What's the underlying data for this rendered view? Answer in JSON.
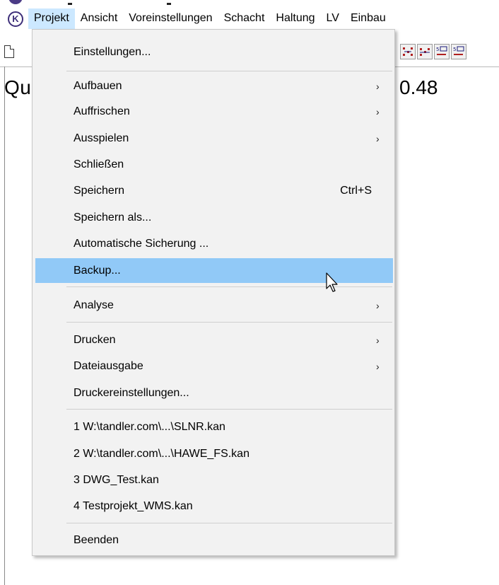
{
  "menubar": {
    "app_icon_glyph": "K",
    "items": [
      {
        "label": "Projekt"
      },
      {
        "label": "Ansicht"
      },
      {
        "label": "Voreinstellungen"
      },
      {
        "label": "Schacht"
      },
      {
        "label": "Haltung"
      },
      {
        "label": "LV"
      },
      {
        "label": "Einbau"
      }
    ]
  },
  "main": {
    "label": "Qu",
    "value": "0.48"
  },
  "dropdown": {
    "items": {
      "einstellungen": "Einstellungen...",
      "aufbauen": "Aufbauen",
      "auffrischen": "Auffrischen",
      "ausspielen": "Ausspielen",
      "schliessen": "Schließen",
      "speichern": "Speichern",
      "speichern_shortcut": "Ctrl+S",
      "speichern_als": "Speichern als...",
      "automatische_sicherung": "Automatische Sicherung ...",
      "backup": "Backup...",
      "analyse": "Analyse",
      "drucken": "Drucken",
      "dateiausgabe": "Dateiausgabe",
      "druckereinstellungen": "Druckereinstellungen...",
      "recent1": "1 W:\\tandler.com\\...\\SLNR.kan",
      "recent2": "2 W:\\tandler.com\\...\\HAWE_FS.kan",
      "recent3": "3 DWG_Test.kan",
      "recent4": "4 Testprojekt_WMS.kan",
      "beenden": "Beenden"
    },
    "submenu_arrow": "›"
  },
  "colors": {
    "menu_background": "#f2f2f2",
    "highlight": "#91c9f7",
    "menubar_active": "#cce8ff",
    "app_icon": "#3e2f7a"
  }
}
